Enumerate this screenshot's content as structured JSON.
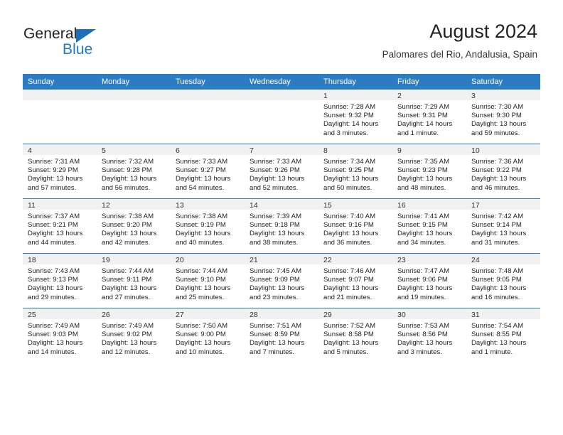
{
  "brand": {
    "name_part1": "General",
    "name_part2": "Blue",
    "triangle_color": "#1c6fb8",
    "text_color": "#231f20",
    "accent_color": "#2079c6"
  },
  "header": {
    "title": "August 2024",
    "subtitle": "Palomares del Rio, Andalusia, Spain"
  },
  "theme": {
    "header_bg": "#2b7cc3",
    "header_text": "#ffffff",
    "daynum_bg": "#f1f1f1",
    "row_border": "#2b7cc3",
    "body_text": "#222222"
  },
  "weekdays": [
    "Sunday",
    "Monday",
    "Tuesday",
    "Wednesday",
    "Thursday",
    "Friday",
    "Saturday"
  ],
  "weeks": [
    [
      {
        "day": "",
        "lines": []
      },
      {
        "day": "",
        "lines": []
      },
      {
        "day": "",
        "lines": []
      },
      {
        "day": "",
        "lines": []
      },
      {
        "day": "1",
        "lines": [
          "Sunrise: 7:28 AM",
          "Sunset: 9:32 PM",
          "Daylight: 14 hours",
          "and 3 minutes."
        ]
      },
      {
        "day": "2",
        "lines": [
          "Sunrise: 7:29 AM",
          "Sunset: 9:31 PM",
          "Daylight: 14 hours",
          "and 1 minute."
        ]
      },
      {
        "day": "3",
        "lines": [
          "Sunrise: 7:30 AM",
          "Sunset: 9:30 PM",
          "Daylight: 13 hours",
          "and 59 minutes."
        ]
      }
    ],
    [
      {
        "day": "4",
        "lines": [
          "Sunrise: 7:31 AM",
          "Sunset: 9:29 PM",
          "Daylight: 13 hours",
          "and 57 minutes."
        ]
      },
      {
        "day": "5",
        "lines": [
          "Sunrise: 7:32 AM",
          "Sunset: 9:28 PM",
          "Daylight: 13 hours",
          "and 56 minutes."
        ]
      },
      {
        "day": "6",
        "lines": [
          "Sunrise: 7:33 AM",
          "Sunset: 9:27 PM",
          "Daylight: 13 hours",
          "and 54 minutes."
        ]
      },
      {
        "day": "7",
        "lines": [
          "Sunrise: 7:33 AM",
          "Sunset: 9:26 PM",
          "Daylight: 13 hours",
          "and 52 minutes."
        ]
      },
      {
        "day": "8",
        "lines": [
          "Sunrise: 7:34 AM",
          "Sunset: 9:25 PM",
          "Daylight: 13 hours",
          "and 50 minutes."
        ]
      },
      {
        "day": "9",
        "lines": [
          "Sunrise: 7:35 AM",
          "Sunset: 9:23 PM",
          "Daylight: 13 hours",
          "and 48 minutes."
        ]
      },
      {
        "day": "10",
        "lines": [
          "Sunrise: 7:36 AM",
          "Sunset: 9:22 PM",
          "Daylight: 13 hours",
          "and 46 minutes."
        ]
      }
    ],
    [
      {
        "day": "11",
        "lines": [
          "Sunrise: 7:37 AM",
          "Sunset: 9:21 PM",
          "Daylight: 13 hours",
          "and 44 minutes."
        ]
      },
      {
        "day": "12",
        "lines": [
          "Sunrise: 7:38 AM",
          "Sunset: 9:20 PM",
          "Daylight: 13 hours",
          "and 42 minutes."
        ]
      },
      {
        "day": "13",
        "lines": [
          "Sunrise: 7:38 AM",
          "Sunset: 9:19 PM",
          "Daylight: 13 hours",
          "and 40 minutes."
        ]
      },
      {
        "day": "14",
        "lines": [
          "Sunrise: 7:39 AM",
          "Sunset: 9:18 PM",
          "Daylight: 13 hours",
          "and 38 minutes."
        ]
      },
      {
        "day": "15",
        "lines": [
          "Sunrise: 7:40 AM",
          "Sunset: 9:16 PM",
          "Daylight: 13 hours",
          "and 36 minutes."
        ]
      },
      {
        "day": "16",
        "lines": [
          "Sunrise: 7:41 AM",
          "Sunset: 9:15 PM",
          "Daylight: 13 hours",
          "and 34 minutes."
        ]
      },
      {
        "day": "17",
        "lines": [
          "Sunrise: 7:42 AM",
          "Sunset: 9:14 PM",
          "Daylight: 13 hours",
          "and 31 minutes."
        ]
      }
    ],
    [
      {
        "day": "18",
        "lines": [
          "Sunrise: 7:43 AM",
          "Sunset: 9:13 PM",
          "Daylight: 13 hours",
          "and 29 minutes."
        ]
      },
      {
        "day": "19",
        "lines": [
          "Sunrise: 7:44 AM",
          "Sunset: 9:11 PM",
          "Daylight: 13 hours",
          "and 27 minutes."
        ]
      },
      {
        "day": "20",
        "lines": [
          "Sunrise: 7:44 AM",
          "Sunset: 9:10 PM",
          "Daylight: 13 hours",
          "and 25 minutes."
        ]
      },
      {
        "day": "21",
        "lines": [
          "Sunrise: 7:45 AM",
          "Sunset: 9:09 PM",
          "Daylight: 13 hours",
          "and 23 minutes."
        ]
      },
      {
        "day": "22",
        "lines": [
          "Sunrise: 7:46 AM",
          "Sunset: 9:07 PM",
          "Daylight: 13 hours",
          "and 21 minutes."
        ]
      },
      {
        "day": "23",
        "lines": [
          "Sunrise: 7:47 AM",
          "Sunset: 9:06 PM",
          "Daylight: 13 hours",
          "and 19 minutes."
        ]
      },
      {
        "day": "24",
        "lines": [
          "Sunrise: 7:48 AM",
          "Sunset: 9:05 PM",
          "Daylight: 13 hours",
          "and 16 minutes."
        ]
      }
    ],
    [
      {
        "day": "25",
        "lines": [
          "Sunrise: 7:49 AM",
          "Sunset: 9:03 PM",
          "Daylight: 13 hours",
          "and 14 minutes."
        ]
      },
      {
        "day": "26",
        "lines": [
          "Sunrise: 7:49 AM",
          "Sunset: 9:02 PM",
          "Daylight: 13 hours",
          "and 12 minutes."
        ]
      },
      {
        "day": "27",
        "lines": [
          "Sunrise: 7:50 AM",
          "Sunset: 9:00 PM",
          "Daylight: 13 hours",
          "and 10 minutes."
        ]
      },
      {
        "day": "28",
        "lines": [
          "Sunrise: 7:51 AM",
          "Sunset: 8:59 PM",
          "Daylight: 13 hours",
          "and 7 minutes."
        ]
      },
      {
        "day": "29",
        "lines": [
          "Sunrise: 7:52 AM",
          "Sunset: 8:58 PM",
          "Daylight: 13 hours",
          "and 5 minutes."
        ]
      },
      {
        "day": "30",
        "lines": [
          "Sunrise: 7:53 AM",
          "Sunset: 8:56 PM",
          "Daylight: 13 hours",
          "and 3 minutes."
        ]
      },
      {
        "day": "31",
        "lines": [
          "Sunrise: 7:54 AM",
          "Sunset: 8:55 PM",
          "Daylight: 13 hours",
          "and 1 minute."
        ]
      }
    ]
  ]
}
